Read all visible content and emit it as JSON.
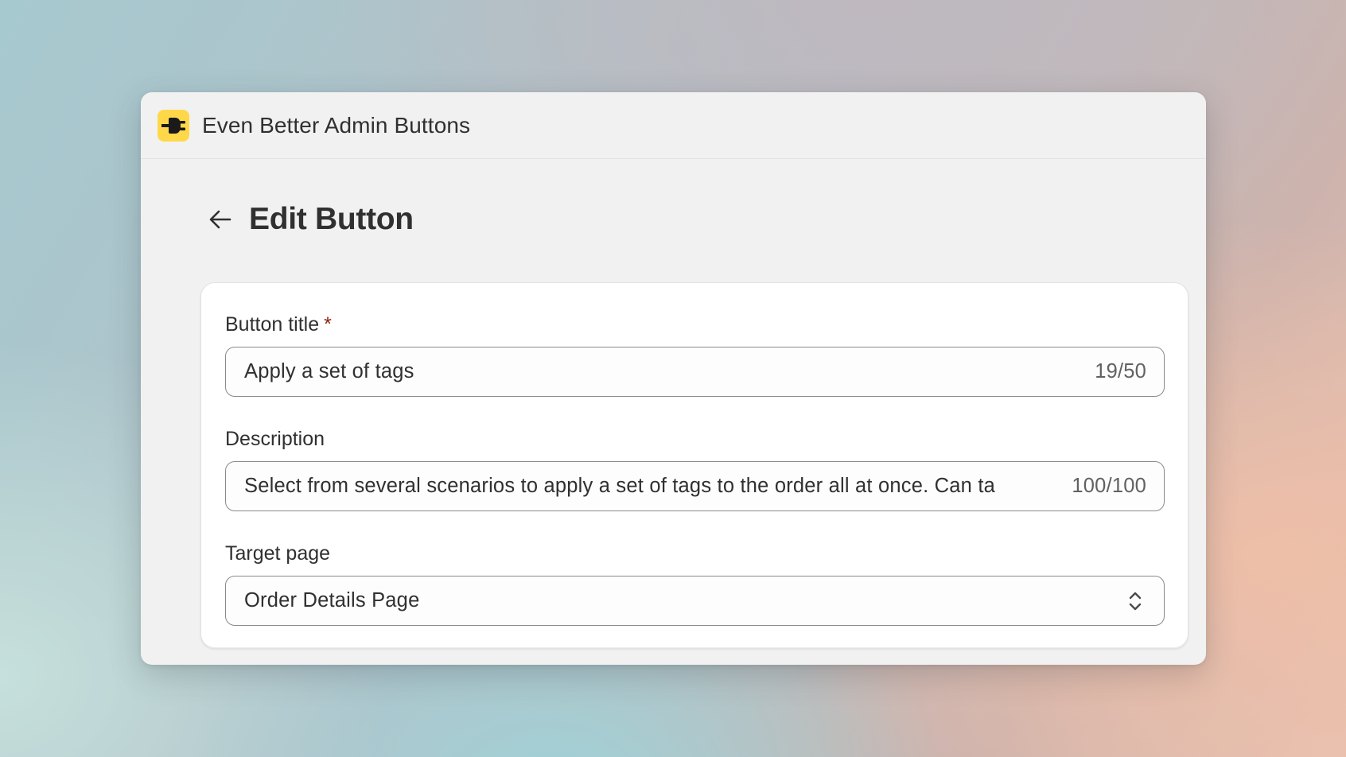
{
  "app": {
    "title": "Even Better Admin Buttons",
    "icon": "plug-icon",
    "icon_bg": "#ffd84a"
  },
  "page": {
    "title": "Edit Button",
    "back_icon": "arrow-left-icon"
  },
  "form": {
    "button_title": {
      "label": "Button title",
      "required_marker": "*",
      "value": "Apply a set of tags",
      "counter": "19/50"
    },
    "description": {
      "label": "Description",
      "value": "Select from several scenarios to apply a set of tags to the order all at once. Can ta",
      "counter": "100/100"
    },
    "target_page": {
      "label": "Target page",
      "selected": "Order Details Page",
      "icon": "select-arrows-icon"
    }
  },
  "colors": {
    "required": "#8e1f0b",
    "text": "#303030",
    "muted": "#616161"
  }
}
